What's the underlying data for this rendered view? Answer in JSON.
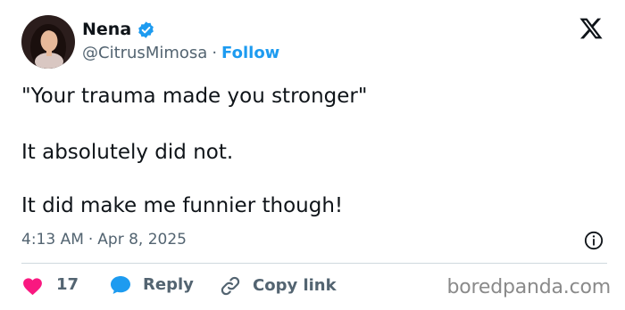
{
  "author": {
    "name": "Nena",
    "handle": "@CitrusMimosa",
    "separator": "·",
    "follow_label": "Follow"
  },
  "icons": {
    "avatar": "avatar-photo",
    "verified": "verified-badge-icon",
    "platform": "x-logo-icon",
    "info": "info-icon",
    "like": "heart-icon",
    "reply": "reply-bubble-icon",
    "copy": "link-icon"
  },
  "tweet": {
    "lines": [
      "\"Your trauma made you stronger\"",
      "It absolutely did not.",
      "It did make me funnier though!"
    ]
  },
  "meta": {
    "time": "4:13 AM",
    "separator": "·",
    "date": "Apr 8, 2025"
  },
  "actions": {
    "like_count": "17",
    "reply_label": "Reply",
    "copy_label": "Copy link"
  },
  "watermark": "boredpanda.com",
  "colors": {
    "accent": "#1d9bf0",
    "like": "#f91880",
    "text": "#0f1419",
    "muted": "#536471"
  }
}
